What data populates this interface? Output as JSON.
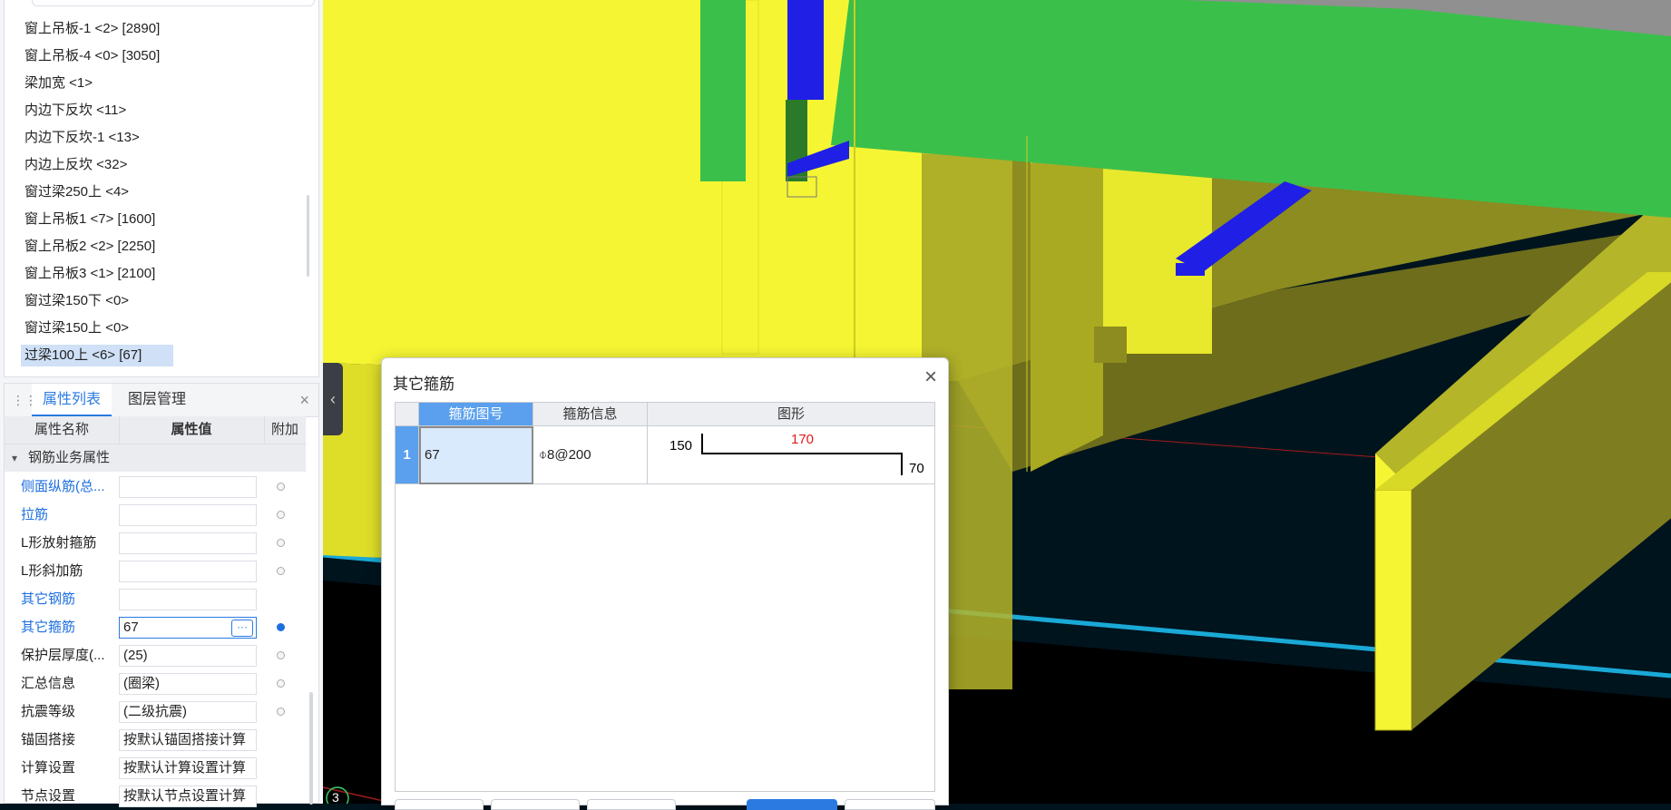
{
  "tree": {
    "items": [
      "窗上吊板-1 <2> [2890]",
      "窗上吊板-4 <0> [3050]",
      "梁加宽 <1>",
      "内边下反坎 <11>",
      "内边下反坎-1 <13>",
      "内边上反坎 <32>",
      "窗过梁250上 <4>",
      "窗上吊板1 <7> [1600]",
      "窗上吊板2 <2> [2250]",
      "窗上吊板3 <1> [2100]",
      "窗过梁150下 <0>",
      "窗过梁150上 <0>",
      "过梁100上 <6> [67]"
    ],
    "selected_index": 12
  },
  "props_panel": {
    "tabs": [
      "属性列表",
      "图层管理"
    ],
    "close": "×",
    "grip": "⋮⋮",
    "headers": {
      "name": "属性名称",
      "value": "属性值",
      "extra": "附加"
    },
    "group": "钢筋业务属性",
    "group_toggle": "▾",
    "rows": [
      {
        "name": "侧面纵筋(总...",
        "value": "",
        "blue": true,
        "dot": "off"
      },
      {
        "name": "拉筋",
        "value": "",
        "blue": true,
        "dot": "off"
      },
      {
        "name": "L形放射箍筋",
        "value": "",
        "blue": false,
        "dot": "off"
      },
      {
        "name": "L形斜加筋",
        "value": "",
        "blue": false,
        "dot": "off"
      },
      {
        "name": "其它钢筋",
        "value": "",
        "blue": true,
        "dot": "none"
      },
      {
        "name": "其它箍筋",
        "value": "67",
        "blue": true,
        "dot": "on",
        "has_button": true
      },
      {
        "name": "保护层厚度(...",
        "value": "(25)",
        "blue": false,
        "dot": "off"
      },
      {
        "name": "汇总信息",
        "value": "(圈梁)",
        "blue": false,
        "dot": "off"
      },
      {
        "name": "抗震等级",
        "value": "(二级抗震)",
        "blue": false,
        "dot": "off"
      },
      {
        "name": "锚固搭接",
        "value": "按默认锚固搭接计算",
        "blue": false,
        "dot": "none"
      },
      {
        "name": "计算设置",
        "value": "按默认计算设置计算",
        "blue": false,
        "dot": "none"
      },
      {
        "name": "节点设置",
        "value": "按默认节点设置计算",
        "blue": false,
        "dot": "none"
      }
    ],
    "ellipsis": "···"
  },
  "collapse_arrow": "‹",
  "viewport": {
    "axis_label": "3"
  },
  "dialog": {
    "title": "其它箍筋",
    "close": "×",
    "columns": [
      "箍筋图号",
      "箍筋信息",
      "图形"
    ],
    "rows": [
      {
        "num": "1",
        "code": "67",
        "info": "⌽8@200",
        "shape_left": "150",
        "shape_top": "170",
        "shape_right": "70"
      }
    ]
  },
  "colors": {
    "accent": "#2a7ae2",
    "yellow": "#ffff33",
    "green": "#39bf4b",
    "blue": "#1f1fe6",
    "cyan": "#1aa9d6",
    "background": "#00141e"
  }
}
